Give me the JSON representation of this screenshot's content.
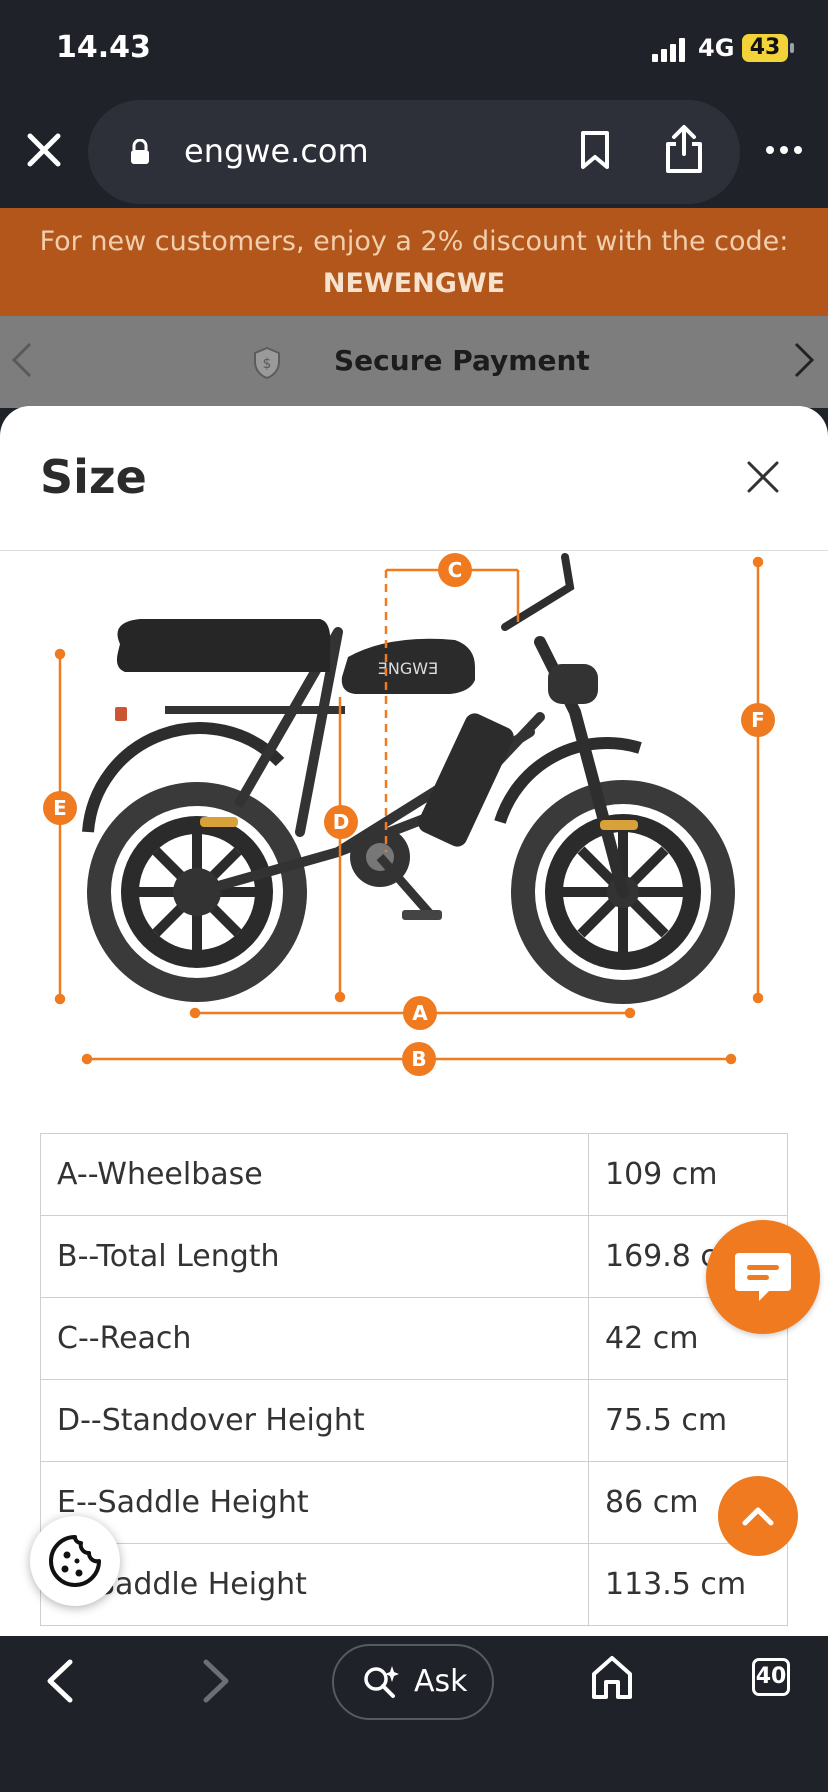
{
  "status_bar": {
    "time": "14.43",
    "network": "4G",
    "battery": "43"
  },
  "browser": {
    "url": "engwe.com"
  },
  "promo": {
    "text": "For new customers, enjoy a 2% discount with the code:",
    "code": "NEWENGWE"
  },
  "strip": {
    "secure_label": "Secure Payment"
  },
  "modal": {
    "title": "Size"
  },
  "diagram": {
    "brand_mark": "ƎNGWƎ",
    "markers": [
      "A",
      "B",
      "C",
      "D",
      "E",
      "F"
    ],
    "accent_color": "#f07a1f"
  },
  "size_table": {
    "rows": [
      {
        "label": "A--Wheelbase",
        "value": "109 cm"
      },
      {
        "label": "B--Total Length",
        "value": "169.8 cm"
      },
      {
        "label": "C--Reach",
        "value": "42 cm"
      },
      {
        "label": "D--Standover Height",
        "value": "75.5 cm"
      },
      {
        "label": "E--Saddle Height",
        "value": "86 cm"
      },
      {
        "label": "F--Saddle Height",
        "value": "113.5 cm"
      }
    ]
  },
  "bottom_nav": {
    "ask_label": "Ask",
    "tab_count": "40"
  },
  "icons": {
    "close": "close-icon",
    "lock": "lock-icon",
    "bookmark": "bookmark-icon",
    "share": "share-icon",
    "menu": "more-icon",
    "shield": "shield-dollar-icon",
    "chat": "chat-icon",
    "scroll_top": "chevron-up-icon",
    "cookie": "cookie-icon",
    "back": "chevron-left-icon",
    "forward": "chevron-right-icon",
    "ask": "sparkle-search-icon",
    "home": "home-icon",
    "tabs": "tabs-icon"
  },
  "colors": {
    "accent": "#f07a1f",
    "banner": "#b3561b",
    "chrome": "#1f2229"
  }
}
